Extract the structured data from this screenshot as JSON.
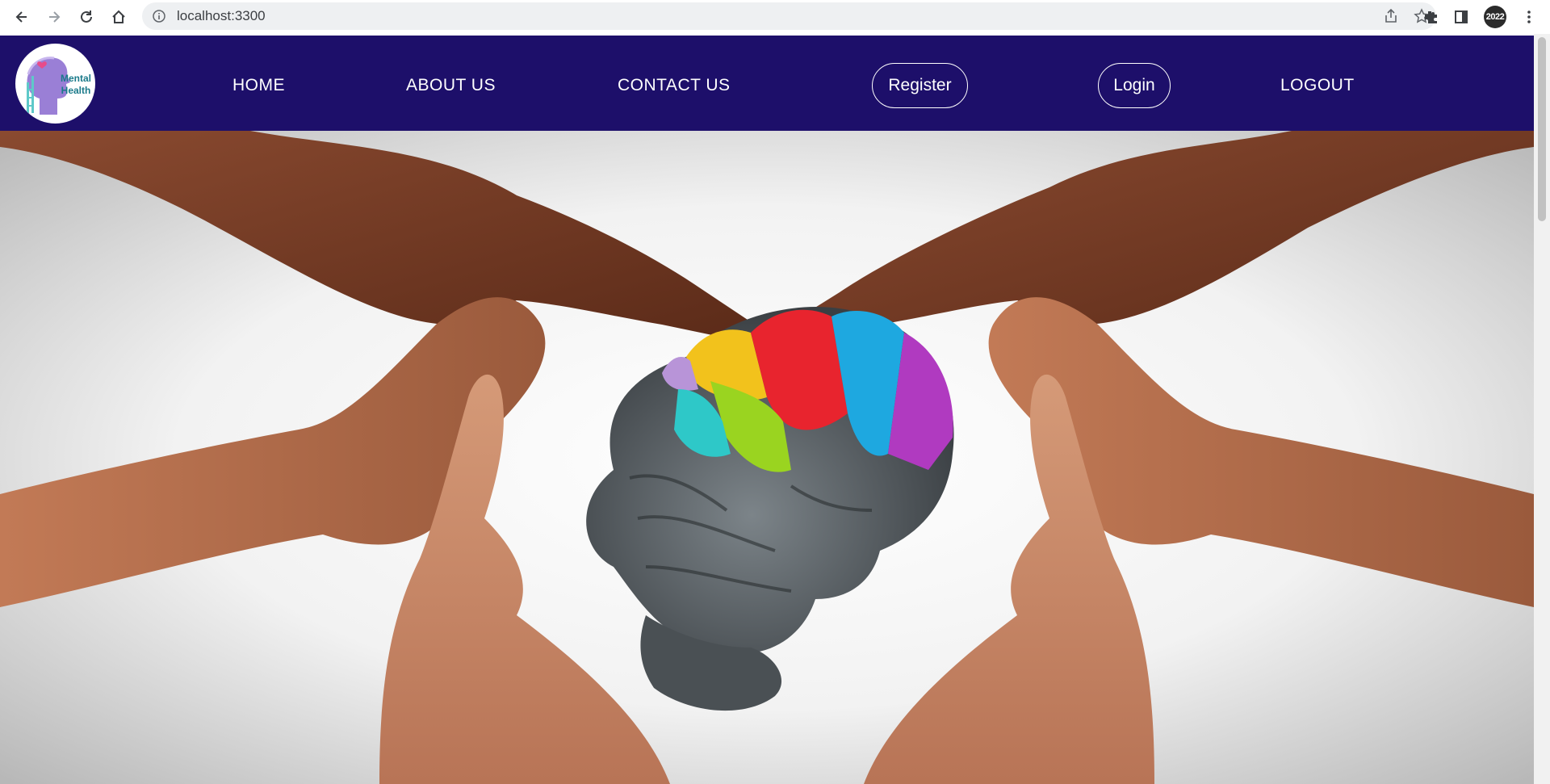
{
  "browser": {
    "url": "localhost:3300",
    "profile_label": "2022"
  },
  "site": {
    "logo_text_line1": "Mental",
    "logo_text_line2": "Health",
    "nav": {
      "home": "HOME",
      "about": "ABOUT US",
      "contact": "CONTACT US",
      "register": "Register",
      "login": "Login",
      "logout": "LOGOUT"
    },
    "colors": {
      "nav_bg": "#1d0f6a",
      "nav_text": "#ffffff"
    }
  },
  "hero": {
    "image": "hands-forming-heart-around-colorful-brain"
  }
}
